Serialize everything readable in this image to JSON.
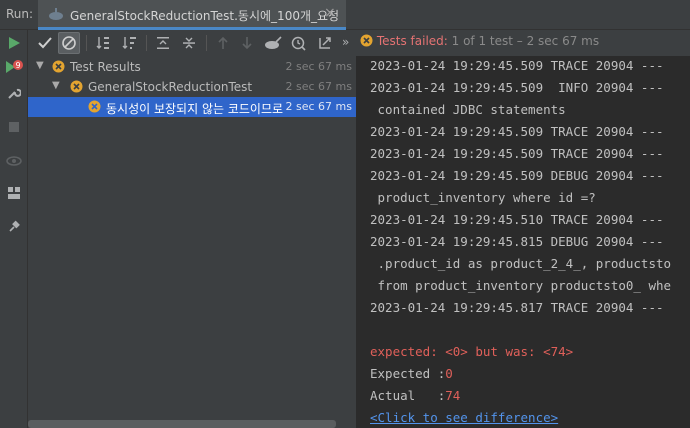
{
  "runbar": {
    "label": "Run:",
    "tab_title": "GeneralStockReductionTest.동시에_100개_요청",
    "tab_close": "×"
  },
  "toolbar": {
    "more": "»",
    "status_failed": "Tests failed: ",
    "status_rest": "1 of 1 test – 2 sec 67 ms"
  },
  "tree": {
    "rows": [
      {
        "label": "Test Results",
        "time": "2 sec 67 ms"
      },
      {
        "label": "GeneralStockReductionTest",
        "time": "2 sec 67 ms"
      },
      {
        "label": "동시성이 보장되지 않는 코드이므로",
        "time": "2 sec 67 ms"
      }
    ]
  },
  "console": {
    "lines": [
      "2023-01-24 19:29:45.509 TRACE 20904 ---",
      "2023-01-24 19:29:45.509  INFO 20904 ---",
      " contained JDBC statements",
      "2023-01-24 19:29:45.509 TRACE 20904 ---",
      "2023-01-24 19:29:45.509 TRACE 20904 ---",
      "2023-01-24 19:29:45.509 DEBUG 20904 ---",
      " product_inventory where id =?",
      "2023-01-24 19:29:45.510 TRACE 20904 ---",
      "2023-01-24 19:29:45.815 DEBUG 20904 ---",
      " .product_id as product_2_4_, productsto",
      " from product_inventory productsto0_ whe",
      "2023-01-24 19:29:45.817 TRACE 20904 ---"
    ],
    "expected_msg": "expected: <0> but was: <74>",
    "expected_label": "Expected :",
    "expected_value": "0",
    "actual_label": "Actual   :",
    "actual_value": "74",
    "diff_link": "<Click to see difference>"
  },
  "colors": {
    "accent": "#4a88c7",
    "selection": "#2f65ca",
    "error": "#e0605a",
    "link": "#5394ec",
    "warning_icon": "#e3a430"
  }
}
